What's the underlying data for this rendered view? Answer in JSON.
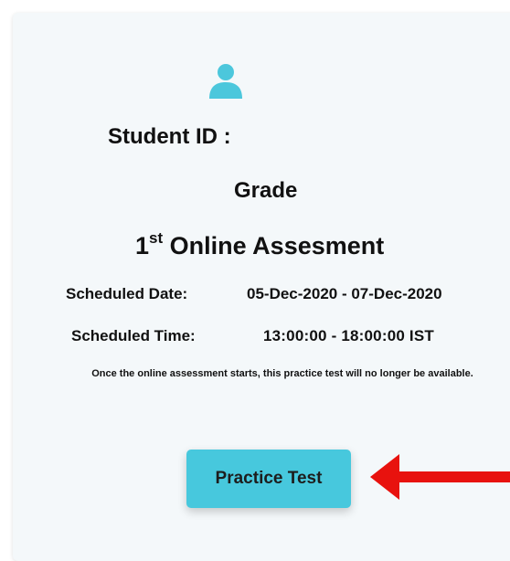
{
  "header": {
    "icon": "user-icon",
    "student_id_label": "Student ID :",
    "grade_label": "Grade"
  },
  "assessment": {
    "ordinal_number": "1",
    "ordinal_suffix": "st",
    "title": "Online Assesment"
  },
  "schedule": {
    "date_label": "Scheduled Date:",
    "date_value": "05-Dec-2020 - 07-Dec-2020",
    "time_label": "Scheduled Time:",
    "time_value": "13:00:00 - 18:00:00 IST"
  },
  "note": "Once the online assessment starts, this practice test will no longer be available.",
  "actions": {
    "practice_button": "Practice Test"
  },
  "colors": {
    "accent": "#47c8dd",
    "icon": "#4cc7dc",
    "arrow": "#e8120e",
    "card_bg": "#f4f8fa"
  }
}
